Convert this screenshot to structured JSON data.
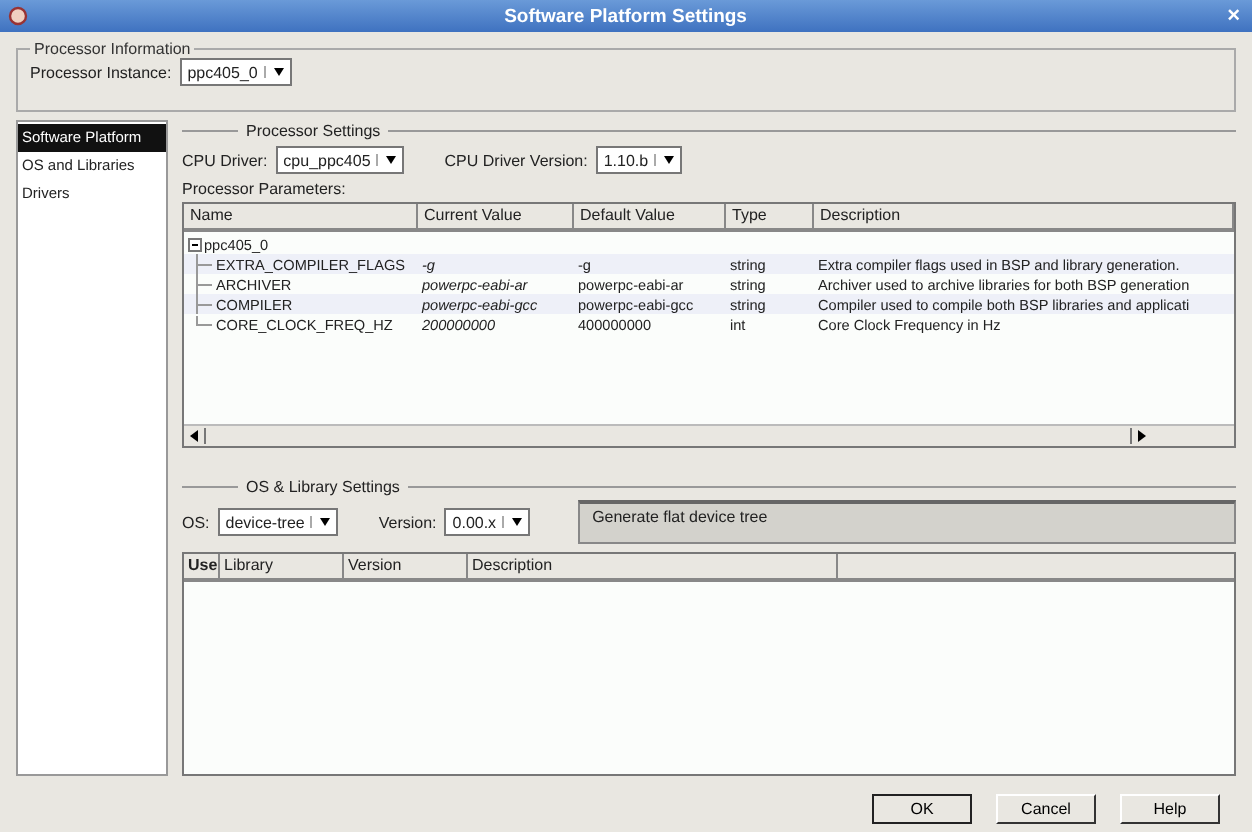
{
  "window": {
    "title": "Software Platform Settings",
    "close": "×"
  },
  "processor_information": {
    "title": "Processor Information",
    "instance_label": "Processor Instance:",
    "instance_value": "ppc405_0"
  },
  "sidebar": {
    "items": [
      {
        "label": "Software Platform",
        "selected": true
      },
      {
        "label": "OS and Libraries",
        "selected": false
      },
      {
        "label": "Drivers",
        "selected": false
      }
    ]
  },
  "processor_settings": {
    "title": "Processor Settings",
    "cpu_driver_label": "CPU Driver:",
    "cpu_driver_value": "cpu_ppc405",
    "cpu_version_label": "CPU Driver Version:",
    "cpu_version_value": "1.10.b",
    "parameters_label": "Processor Parameters:",
    "table": {
      "columns": [
        "Name",
        "Current Value",
        "Default Value",
        "Type",
        "Description"
      ],
      "root": {
        "name": "ppc405_0",
        "expanded": true,
        "children": [
          {
            "name": "EXTRA_COMPILER_FLAGS",
            "current": "-g",
            "default": "-g",
            "type": "string",
            "description": "Extra compiler flags used in BSP and library generation."
          },
          {
            "name": "ARCHIVER",
            "current": "powerpc-eabi-ar",
            "default": "powerpc-eabi-ar",
            "type": "string",
            "description": "Archiver used to archive libraries for both BSP generation"
          },
          {
            "name": "COMPILER",
            "current": "powerpc-eabi-gcc",
            "default": "powerpc-eabi-gcc",
            "type": "string",
            "description": "Compiler used to compile both BSP libraries and applicati"
          },
          {
            "name": "CORE_CLOCK_FREQ_HZ",
            "current": "200000000",
            "default": "400000000",
            "type": "int",
            "description": "Core Clock Frequency in Hz"
          }
        ]
      }
    }
  },
  "os_library_settings": {
    "title": "OS & Library Settings",
    "os_label": "OS:",
    "os_value": "device-tree",
    "version_label": "Version:",
    "version_value": "0.00.x",
    "os_description": "Generate flat device tree",
    "table": {
      "columns": [
        "Use",
        "Library",
        "Version",
        "Description"
      ]
    }
  },
  "buttons": [
    "OK",
    "Cancel",
    "Help"
  ]
}
